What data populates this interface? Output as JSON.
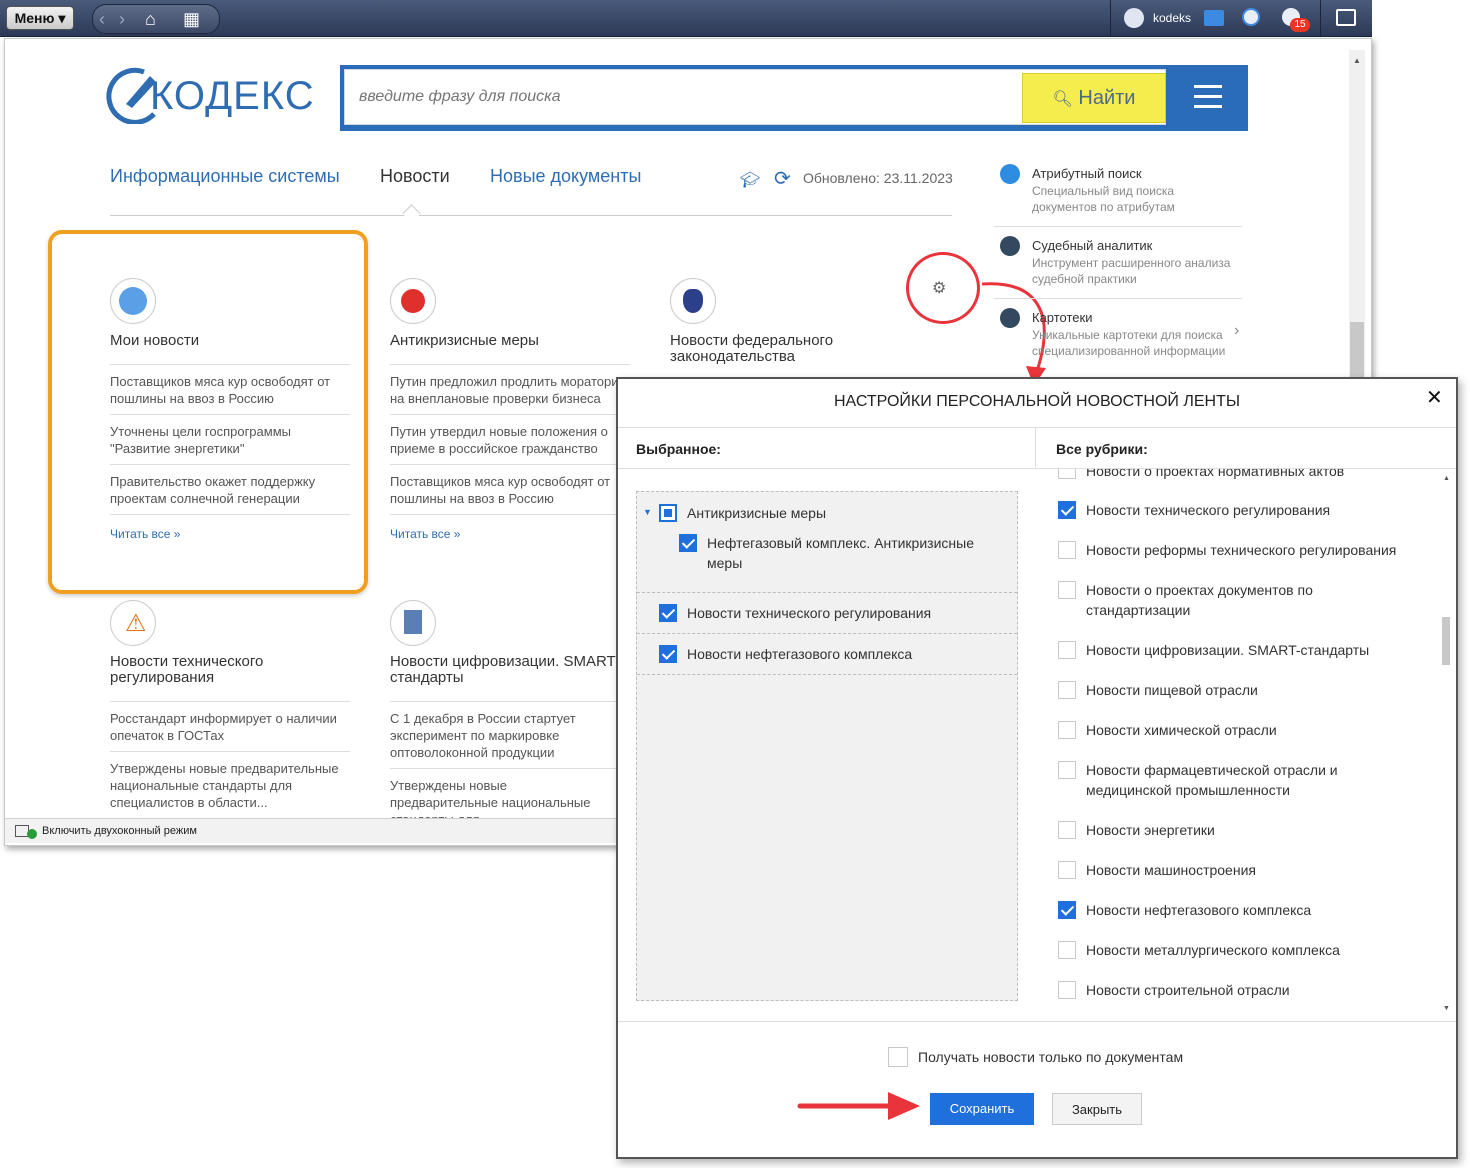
{
  "topbar": {
    "menu_label": "Меню",
    "username": "kodeks",
    "notification_count": "15"
  },
  "brand": {
    "logo_text": "КОДЕКС"
  },
  "search": {
    "placeholder": "введите фразу для поиска",
    "button_label": "Найти"
  },
  "tabs": [
    {
      "label": "Информационные системы"
    },
    {
      "label": "Новости"
    },
    {
      "label": "Новые документы"
    }
  ],
  "updated_label": "Обновлено: 23.11.2023",
  "cards": [
    {
      "title": "Мои новости",
      "items": [
        "Поставщиков мяса кур освободят от пошлины на ввоз в Россию",
        "Уточнены цели госпрограммы \"Развитие энергетики\"",
        "Правительство окажет поддержку проектам солнечной генерации"
      ],
      "read_all": "Читать все »"
    },
    {
      "title": "Антикризисные меры",
      "items": [
        "Путин предложил продлить моратори на внеплановые проверки бизнеса",
        "Путин утвердил новые положения о приеме в российское гражданство",
        "Поставщиков мяса кур освободят от пошлины на ввоз в Россию"
      ],
      "read_all": "Читать все »"
    },
    {
      "title": "Новости федерального законодательства"
    },
    {
      "title": "Новости технического регулирования",
      "items": [
        "Росстандарт информирует о наличии опечаток в ГОСТах",
        "Утверждены новые предварительные национальные стандарты для специалистов в области..."
      ]
    },
    {
      "title": "Новости цифровизации. SMART стандарты",
      "items": [
        "С 1 декабря в России стартует эксперимент по маркировке оптоволоконной продукции",
        "Утверждены новые предварительные национальные стандарты для"
      ]
    }
  ],
  "tools": [
    {
      "title": "Атрибутный поиск",
      "desc": "Специальный вид поиска документов по атрибутам"
    },
    {
      "title": "Судебный аналитик",
      "desc": "Инструмент расширенного анализа судебной практики"
    },
    {
      "title": "Картотеки",
      "desc": "Уникальные картотеки для поиска специализированной информации"
    }
  ],
  "statusbar": {
    "label": "Включить двухоконный режим"
  },
  "dialog": {
    "title": "НАСТРОЙКИ ПЕРСОНАЛЬНОЙ НОВОСТНОЙ ЛЕНТЫ",
    "close": "✕",
    "left_header": "Выбранное:",
    "right_header": "Все рубрики:",
    "selected": [
      {
        "label": "Антикризисные меры",
        "state": "partial"
      },
      {
        "label": "Нефтегазовый комплекс. Антикризисные меры",
        "state": "checked"
      },
      {
        "label": "Новости технического регулирования",
        "state": "checked"
      },
      {
        "label": "Новости нефтегазового комплекса",
        "state": "checked"
      }
    ],
    "rubrics": [
      {
        "label": "Новости о проектах нормативных актов",
        "checked": false
      },
      {
        "label": "Новости технического регулирования",
        "checked": true
      },
      {
        "label": "Новости реформы технического регулирования",
        "checked": false
      },
      {
        "label": "Новости о проектах документов по стандартизации",
        "checked": false
      },
      {
        "label": "Новости цифровизации. SMART-стандарты",
        "checked": false
      },
      {
        "label": "Новости пищевой отрасли",
        "checked": false
      },
      {
        "label": "Новости химической отрасли",
        "checked": false
      },
      {
        "label": "Новости фармацевтической отрасли и медицинской промышленности",
        "checked": false
      },
      {
        "label": "Новости энергетики",
        "checked": false
      },
      {
        "label": "Новости машиностроения",
        "checked": false
      },
      {
        "label": "Новости нефтегазового комплекса",
        "checked": true
      },
      {
        "label": "Новости металлургического комплекса",
        "checked": false
      },
      {
        "label": "Новости строительной отрасли",
        "checked": false
      }
    ],
    "docs_only_label": "Получать новости только по документам",
    "save_label": "Сохранить",
    "close_label": "Закрыть"
  },
  "colors": {
    "accent": "#2f6db3",
    "search_button": "#f5ec4d",
    "highlight": "#f0a020",
    "annotation": "#e8343a"
  }
}
